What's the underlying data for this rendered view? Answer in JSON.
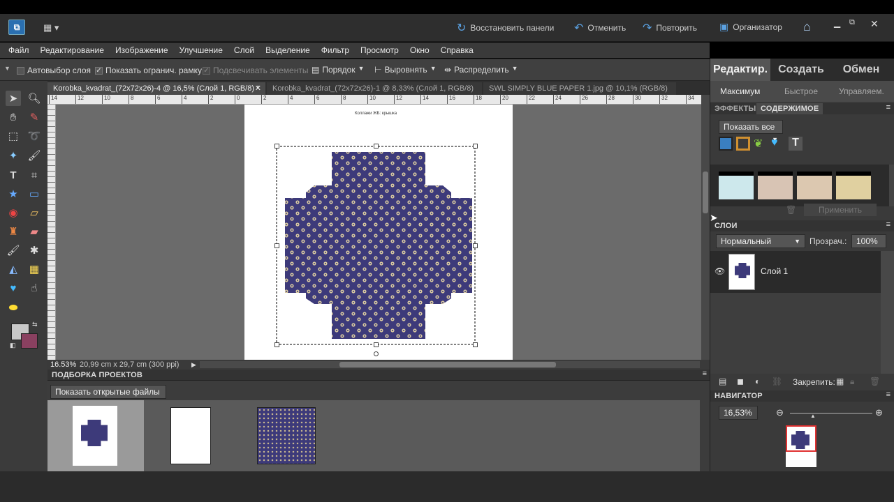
{
  "top": {
    "restore": "Восстановить панели",
    "undo": "Отменить",
    "redo": "Повторить",
    "organizer": "Организатор"
  },
  "menu": [
    "Файл",
    "Редактирование",
    "Изображение",
    "Улучшение",
    "Слой",
    "Выделение",
    "Фильтр",
    "Просмотр",
    "Окно",
    "Справка"
  ],
  "options": {
    "autoselect": "Автовыбор слоя",
    "bounding": "Показать огранич. рамку",
    "highlight": "Подсвечивать элементы",
    "order": "Порядок",
    "align": "Выровнять",
    "distribute": "Распределить"
  },
  "tabs": [
    "Korobka_kvadrat_(72x72x26)-4 @ 16,5% (Слой 1, RGB/8) *",
    "Korobka_kvadrat_(72x72x26)-1 @ 8,33% (Слой 1, RGB/8) *",
    "SWL SIMPLY BLUE PAPER 1.jpg @ 10,1% (RGB/8) *"
  ],
  "ruler": [
    "14",
    "12",
    "10",
    "8",
    "6",
    "4",
    "2",
    "0",
    "2",
    "4",
    "6",
    "8",
    "10",
    "12",
    "14",
    "16",
    "18",
    "20",
    "22",
    "24",
    "26",
    "28",
    "30",
    "32",
    "34"
  ],
  "doc": {
    "title": "Коллажи ЖБ: крышка"
  },
  "status": {
    "zoom": "16.53%",
    "size": "20,99 cm x 29,7 cm (300 ppi)"
  },
  "projbin": {
    "title": "ПОДБОРКА ПРОЕКТОВ",
    "show": "Показать открытые файлы"
  },
  "right": {
    "tabs": [
      "Редактир.",
      "Создать",
      "Обмен"
    ],
    "modes": [
      "Максимум",
      "Быстрое",
      "Управляем."
    ],
    "effects": "ЭФФЕКТЫ",
    "content": "СОДЕРЖИМОЕ",
    "showall": "Показать все",
    "apply": "Применить",
    "layers": "СЛОИ",
    "blend": "Нормальный",
    "opacity_label": "Прозрач.:",
    "opacity": "100%",
    "layer_name": "Слой 1",
    "lock": "Закрепить:",
    "navigator": "НАВИГАТОР",
    "nav_zoom": "16,53%"
  },
  "colors": {
    "fabric": "#3d3a7a",
    "fg": "#c8c8c8",
    "bg": "#8a4060",
    "accent": "#3a7fc0"
  }
}
